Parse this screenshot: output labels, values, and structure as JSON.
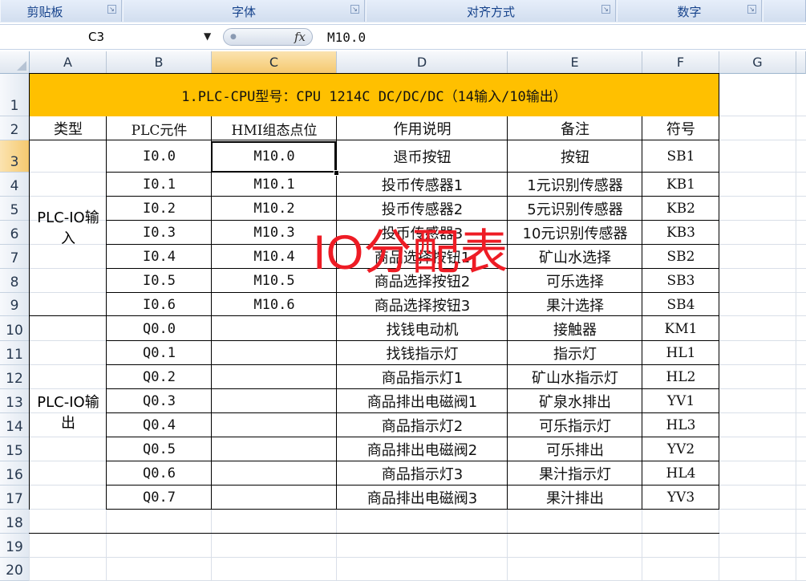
{
  "ribbon": {
    "groups": [
      "剪贴板",
      "字体",
      "对齐方式",
      "数字"
    ]
  },
  "formula_bar": {
    "name_box": "C3",
    "fx_label": "fx",
    "formula": "M10.0"
  },
  "sheet": {
    "columns": [
      "A",
      "B",
      "C",
      "D",
      "E",
      "F",
      "G"
    ],
    "rows": [
      "1",
      "2",
      "3",
      "4",
      "5",
      "6",
      "7",
      "8",
      "9",
      "10",
      "11",
      "12",
      "13",
      "14",
      "15",
      "16",
      "17",
      "18",
      "19",
      "20"
    ],
    "title": "1.PLC-CPU型号：CPU 1214C DC/DC/DC（14输入/10输出）",
    "headers": [
      "类型",
      "PLC元件",
      "HMI组态点位",
      "作用说明",
      "备注",
      "符号"
    ],
    "input_group_label": "PLC-IO输入",
    "output_group_label": "PLC-IO输出",
    "data_rows": [
      {
        "plc": "I0.0",
        "hmi": "M10.0",
        "desc": "退币按钮",
        "note": "按钮",
        "sym": "SB1"
      },
      {
        "plc": "I0.1",
        "hmi": "M10.1",
        "desc": "投币传感器1",
        "note": "1元识别传感器",
        "sym": "KB1"
      },
      {
        "plc": "I0.2",
        "hmi": "M10.2",
        "desc": "投币传感器2",
        "note": "5元识别传感器",
        "sym": "KB2"
      },
      {
        "plc": "I0.3",
        "hmi": "M10.3",
        "desc": "投币传感器3",
        "note": "10元识别传感器",
        "sym": "KB3"
      },
      {
        "plc": "I0.4",
        "hmi": "M10.4",
        "desc": "商品选择按钮1",
        "note": "矿山水选择",
        "sym": "SB2"
      },
      {
        "plc": "I0.5",
        "hmi": "M10.5",
        "desc": "商品选择按钮2",
        "note": "可乐选择",
        "sym": "SB3"
      },
      {
        "plc": "I0.6",
        "hmi": "M10.6",
        "desc": "商品选择按钮3",
        "note": "果汁选择",
        "sym": "SB4"
      },
      {
        "plc": "Q0.0",
        "hmi": "",
        "desc": "找钱电动机",
        "note": "接触器",
        "sym": "KM1"
      },
      {
        "plc": "Q0.1",
        "hmi": "",
        "desc": "找钱指示灯",
        "note": "指示灯",
        "sym": "HL1"
      },
      {
        "plc": "Q0.2",
        "hmi": "",
        "desc": "商品指示灯1",
        "note": "矿山水指示灯",
        "sym": "HL2"
      },
      {
        "plc": "Q0.3",
        "hmi": "",
        "desc": "商品排出电磁阀1",
        "note": "矿泉水排出",
        "sym": "YV1"
      },
      {
        "plc": "Q0.4",
        "hmi": "",
        "desc": "商品指示灯2",
        "note": "可乐指示灯",
        "sym": "HL3"
      },
      {
        "plc": "Q0.5",
        "hmi": "",
        "desc": "商品排出电磁阀2",
        "note": "可乐排出",
        "sym": "YV2"
      },
      {
        "plc": "Q0.6",
        "hmi": "",
        "desc": "商品指示灯3",
        "note": "果汁指示灯",
        "sym": "HL4"
      },
      {
        "plc": "Q0.7",
        "hmi": "",
        "desc": "商品排出电磁阀3",
        "note": "果汁排出",
        "sym": "YV3"
      }
    ]
  },
  "overlay_text": "IO分配表",
  "colors": {
    "title_fill": "#ffc000",
    "overlay": "#ee1c25",
    "selected_header": "#f5c96f"
  }
}
